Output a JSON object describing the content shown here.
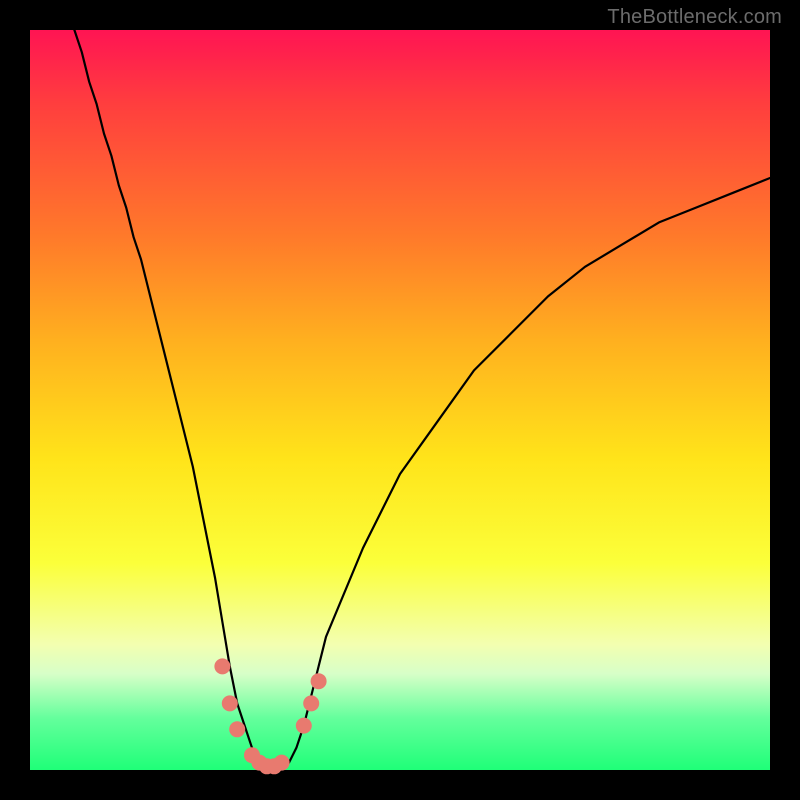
{
  "watermark": "TheBottleneck.com",
  "colors": {
    "frame": "#000000",
    "marker": "#e87a6f",
    "line": "#000000",
    "gradient_stops": [
      "#ff1453",
      "#ff3e3e",
      "#ff7a2a",
      "#ffb01f",
      "#ffe41a",
      "#fbff3a",
      "#f3ffb0",
      "#d7ffc8",
      "#64ff9c",
      "#1fff78"
    ]
  },
  "chart_data": {
    "type": "line",
    "title": "",
    "xlabel": "",
    "ylabel": "",
    "xlim": [
      0,
      100
    ],
    "ylim": [
      0,
      100
    ],
    "grid": false,
    "x": [
      6,
      7,
      8,
      9,
      10,
      11,
      12,
      13,
      14,
      15,
      16,
      17,
      18,
      19,
      20,
      21,
      22,
      23,
      24,
      25,
      26,
      27,
      28,
      29,
      30,
      31,
      32,
      33,
      34,
      35,
      36,
      37,
      38,
      39,
      40,
      45,
      50,
      55,
      60,
      65,
      70,
      75,
      80,
      85,
      90,
      95,
      100
    ],
    "y": [
      100,
      97,
      93,
      90,
      86,
      83,
      79,
      76,
      72,
      69,
      65,
      61,
      57,
      53,
      49,
      45,
      41,
      36,
      31,
      26,
      20,
      14,
      9,
      6,
      3,
      1,
      0,
      0,
      0,
      1,
      3,
      6,
      10,
      14,
      18,
      30,
      40,
      47,
      54,
      59,
      64,
      68,
      71,
      74,
      76,
      78,
      80
    ],
    "series": [
      {
        "name": "bottleneck-curve",
        "x_ref": "x",
        "y_ref": "y"
      }
    ],
    "markers": [
      {
        "x": 26,
        "y": 14
      },
      {
        "x": 27,
        "y": 9
      },
      {
        "x": 28,
        "y": 5.5
      },
      {
        "x": 30,
        "y": 2
      },
      {
        "x": 31,
        "y": 1
      },
      {
        "x": 32,
        "y": 0.5
      },
      {
        "x": 33,
        "y": 0.5
      },
      {
        "x": 34,
        "y": 1
      },
      {
        "x": 37,
        "y": 6
      },
      {
        "x": 38,
        "y": 9
      },
      {
        "x": 39,
        "y": 12
      }
    ],
    "annotations": []
  }
}
